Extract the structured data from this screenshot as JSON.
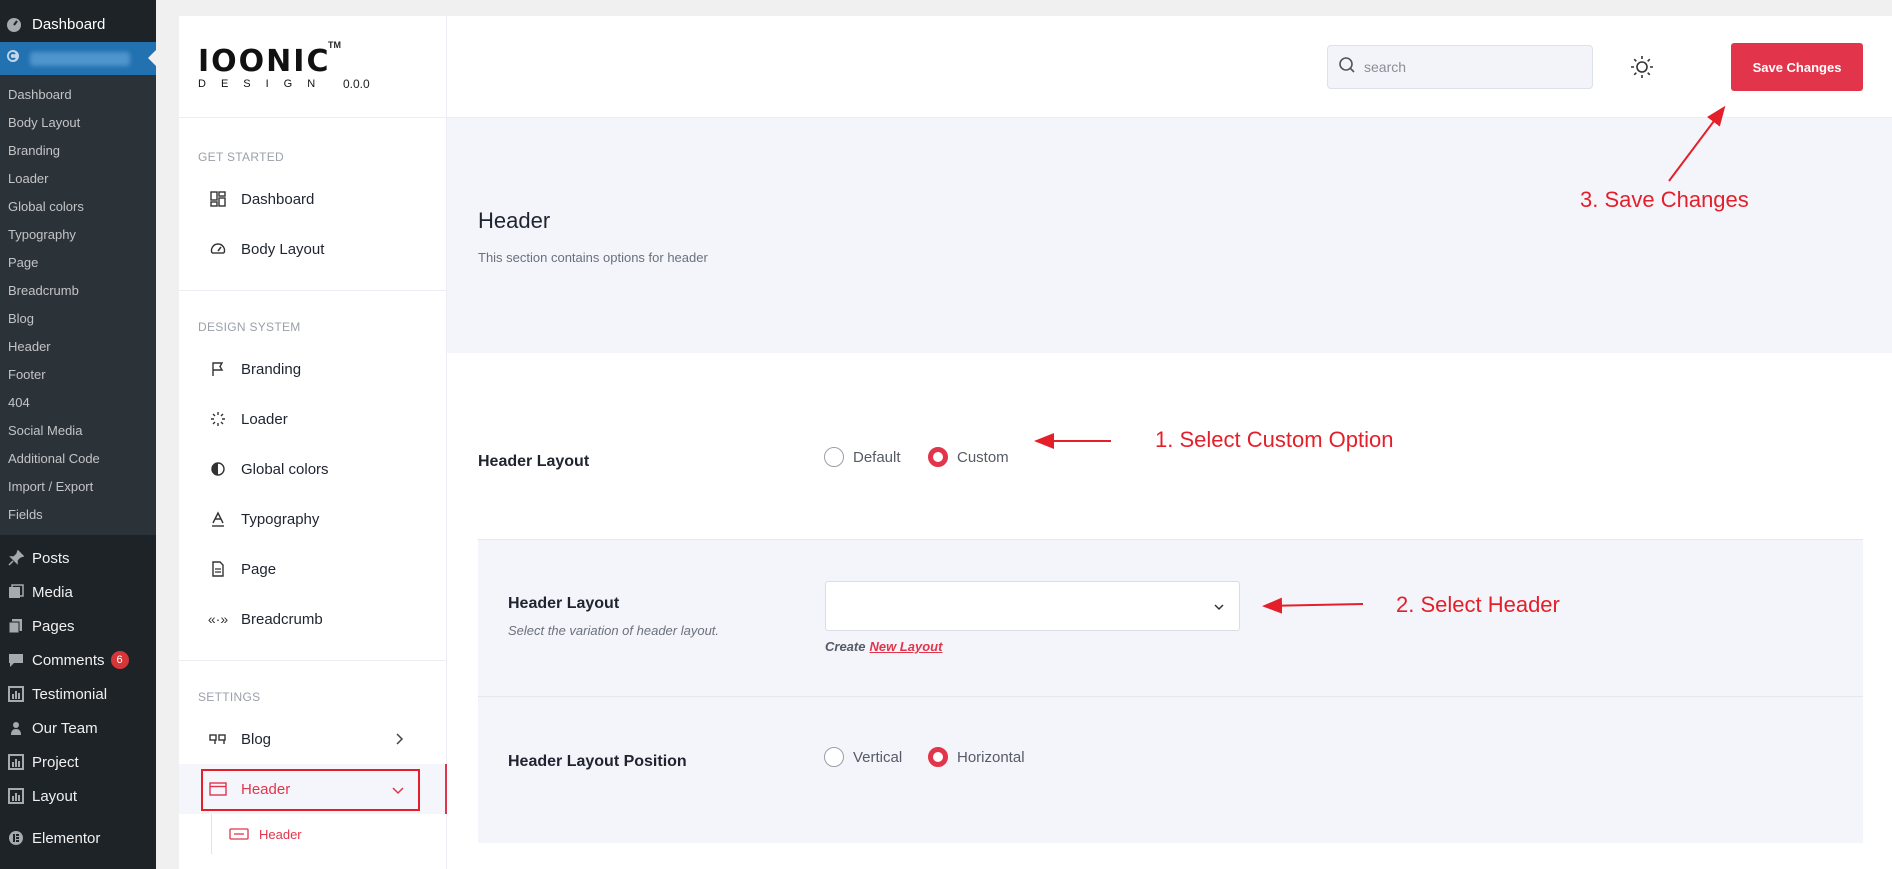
{
  "wp_sidebar": {
    "top_item": "Dashboard",
    "sub_items": [
      "Dashboard",
      "Body Layout",
      "Branding",
      "Loader",
      "Global colors",
      "Typography",
      "Page",
      "Breadcrumb",
      "Blog",
      "Header",
      "Footer",
      "404",
      "Social Media",
      "Additional Code",
      "Import / Export",
      "Fields"
    ],
    "menu": [
      {
        "label": "Posts",
        "icon": "pin-icon"
      },
      {
        "label": "Media",
        "icon": "media-icon"
      },
      {
        "label": "Pages",
        "icon": "pages-icon"
      },
      {
        "label": "Comments",
        "icon": "comment-icon",
        "badge": "6"
      },
      {
        "label": "Testimonial",
        "icon": "testimonial-icon"
      },
      {
        "label": "Our Team",
        "icon": "team-icon"
      },
      {
        "label": "Project",
        "icon": "project-icon"
      },
      {
        "label": "Layout",
        "icon": "layout-icon"
      },
      {
        "label": "Elementor",
        "icon": "elementor-icon"
      }
    ]
  },
  "brand": {
    "logo_text": "IOONIC",
    "tm": "TM",
    "logo_sub": "DESIGN",
    "version": "0.0.0"
  },
  "topbar": {
    "search_placeholder": "search",
    "save_label": "Save Changes"
  },
  "nav": {
    "sections": [
      {
        "heading": "GET STARTED",
        "items": [
          {
            "label": "Dashboard",
            "icon": "grid-icon"
          },
          {
            "label": "Body Layout",
            "icon": "gauge-icon"
          }
        ]
      },
      {
        "heading": "DESIGN SYSTEM",
        "items": [
          {
            "label": "Branding",
            "icon": "flag-icon"
          },
          {
            "label": "Loader",
            "icon": "spinner-icon"
          },
          {
            "label": "Global colors",
            "icon": "contrast-icon"
          },
          {
            "label": "Typography",
            "icon": "text-icon"
          },
          {
            "label": "Page",
            "icon": "file-icon"
          },
          {
            "label": "Breadcrumb",
            "icon": "breadcrumb-icon"
          }
        ]
      },
      {
        "heading": "SETTINGS",
        "items": [
          {
            "label": "Blog",
            "icon": "quote-icon"
          },
          {
            "label": "Header",
            "icon": "window-icon",
            "active": true
          }
        ]
      }
    ],
    "sub_item": "Header"
  },
  "main": {
    "title": "Header",
    "description": "This section contains options for header",
    "row1": {
      "label": "Header Layout",
      "options": [
        "Default",
        "Custom"
      ],
      "selected": "Custom"
    },
    "row2": {
      "label": "Header Layout",
      "hint": "Select the variation of header layout.",
      "select_value": "",
      "create_prefix": "Create",
      "create_link": "New Layout"
    },
    "row3": {
      "label": "Header Layout Position",
      "options": [
        "Vertical",
        "Horizontal"
      ],
      "selected": "Horizontal"
    }
  },
  "annotations": {
    "step1": "1. Select Custom Option",
    "step2": "2. Select Header",
    "step3": "3. Save Changes"
  },
  "colors": {
    "accent": "#e2354b",
    "annotation": "#e51f2a",
    "wp_sidebar": "#1d2327",
    "wp_current": "#2271b1"
  }
}
